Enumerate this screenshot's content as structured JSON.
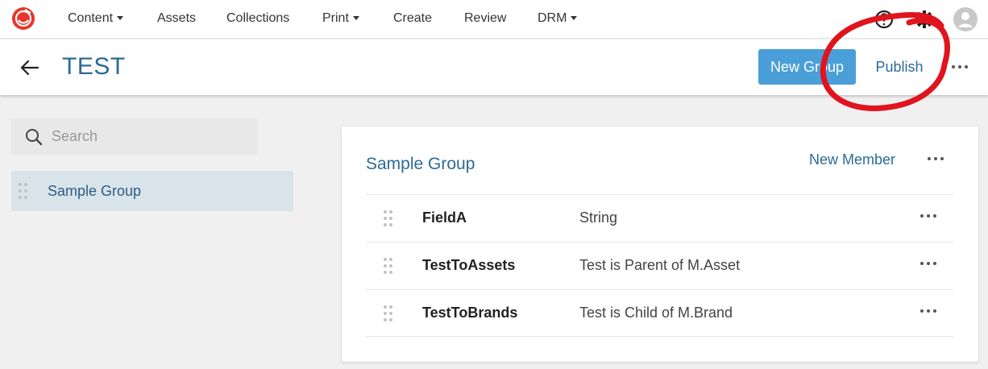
{
  "nav": {
    "items": [
      {
        "label": "Content",
        "dropdown": true
      },
      {
        "label": "Assets",
        "dropdown": false
      },
      {
        "label": "Collections",
        "dropdown": false
      },
      {
        "label": "Print",
        "dropdown": true
      },
      {
        "label": "Create",
        "dropdown": false
      },
      {
        "label": "Review",
        "dropdown": false
      },
      {
        "label": "DRM",
        "dropdown": true
      }
    ],
    "icons": [
      "logo-icon",
      "help-icon",
      "gear-icon",
      "avatar-icon"
    ]
  },
  "header": {
    "title": "TEST",
    "new_group_label": "New Group",
    "publish_label": "Publish"
  },
  "sidebar": {
    "search_placeholder": "Search",
    "items": [
      {
        "label": "Sample Group"
      }
    ]
  },
  "card": {
    "title": "Sample Group",
    "new_member_label": "New Member",
    "fields": [
      {
        "name": "FieldA",
        "type": "String"
      },
      {
        "name": "TestToAssets",
        "type": "Test is Parent of M.Asset"
      },
      {
        "name": "TestToBrands",
        "type": "Test is Child of M.Brand"
      }
    ]
  },
  "colors": {
    "accent": "#4a9fd8",
    "title_blue": "#2d6a96",
    "brand_red": "#e8352b",
    "annotation_red": "#e0141e"
  }
}
